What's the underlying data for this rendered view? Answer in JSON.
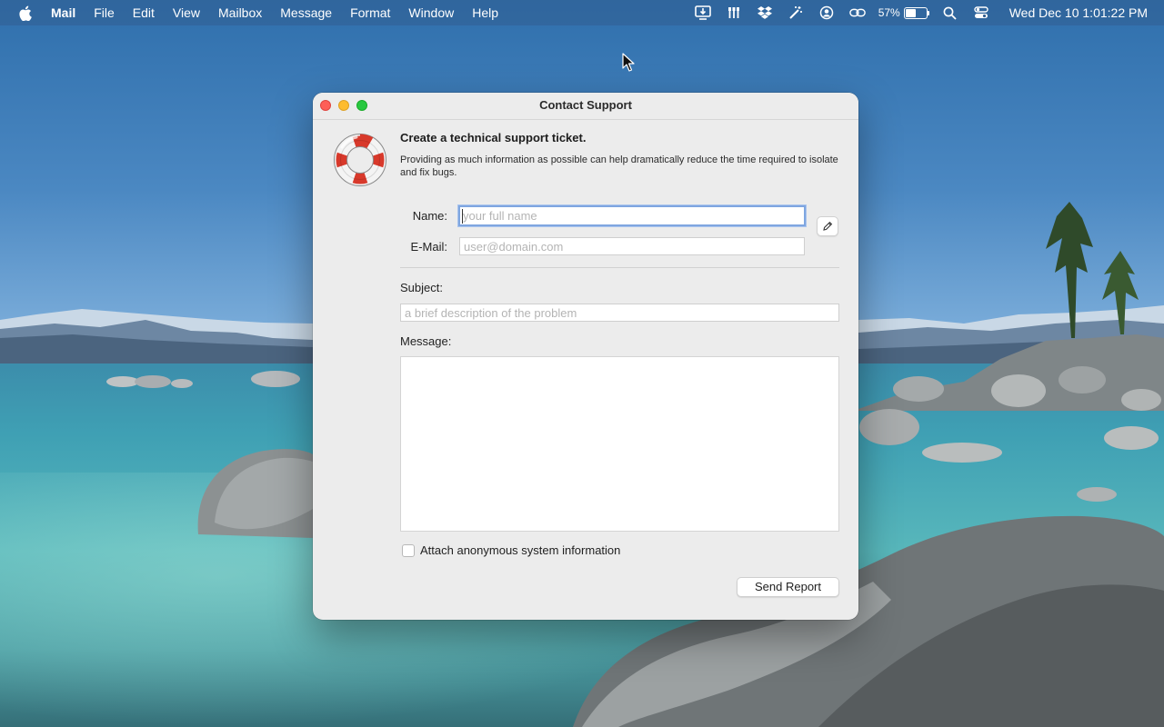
{
  "menubar": {
    "app_name": "Mail",
    "items": [
      "File",
      "Edit",
      "View",
      "Mailbox",
      "Message",
      "Format",
      "Window",
      "Help"
    ],
    "status": {
      "icons": [
        "screen-share-icon",
        "tools-icon",
        "dropbox-icon",
        "magic-wand-icon",
        "user-circle-icon",
        "link-icon",
        "search-icon",
        "control-center-icon"
      ],
      "battery_text": "57%",
      "battery_level": 0.57,
      "clock": "Wed Dec 10  1:01:22 PM"
    }
  },
  "window": {
    "title": "Contact Support",
    "heading": "Create a technical support ticket.",
    "description": "Providing as much information as possible can help dramatically reduce the time required to isolate and fix bugs.",
    "name_label": "Name:",
    "name_placeholder": "your full name",
    "name_value": "",
    "email_label": "E-Mail:",
    "email_placeholder": "user@domain.com",
    "email_value": "",
    "subject_label": "Subject:",
    "subject_placeholder": "a brief description of the problem",
    "subject_value": "",
    "message_label": "Message:",
    "message_value": "",
    "attach_label": "Attach anonymous system information",
    "attach_checked": false,
    "send_button": "Send Report",
    "contact_button_icon": "pencil-icon",
    "logo_icon": "lifebuoy-icon"
  },
  "colors": {
    "focus_ring": "#7fa6e0",
    "traffic_close": "#fe5f57",
    "traffic_minimize": "#febc2e",
    "traffic_maximize": "#28c840",
    "lifebuoy_red": "#d8392b"
  }
}
